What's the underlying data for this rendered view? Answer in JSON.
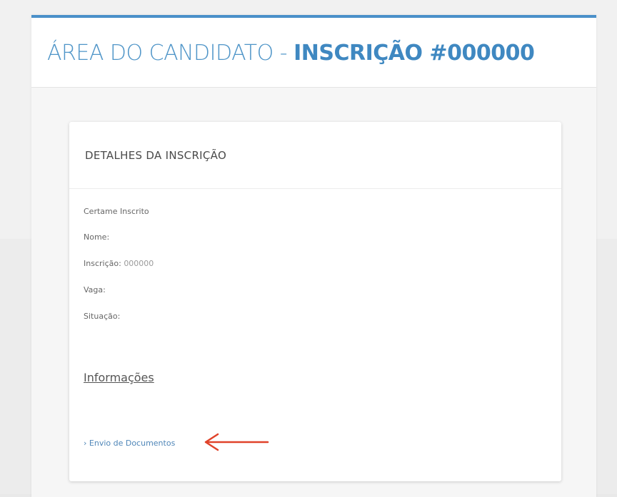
{
  "header": {
    "title_light": "ÁREA DO CANDIDATO - ",
    "title_bold": "INSCRIÇÃO #000000"
  },
  "details": {
    "card_title": "DETALHES DA INSCRIÇÃO",
    "fields": [
      {
        "label": "Certame Inscrito",
        "value": ""
      },
      {
        "label": "Nome:",
        "value": ""
      },
      {
        "label": "Inscrição:",
        "value": "000000"
      },
      {
        "label": "Vaga:",
        "value": ""
      },
      {
        "label": "Situação:",
        "value": ""
      }
    ],
    "info_title": "Informações",
    "links": [
      "› Envio de Documentos"
    ]
  },
  "colors": {
    "accent": "#4a90c9",
    "title": "#4f95c8",
    "link": "#4f86b8",
    "annotation_arrow": "#e0432a"
  },
  "icons": {
    "annotation": "left-arrow-icon"
  }
}
